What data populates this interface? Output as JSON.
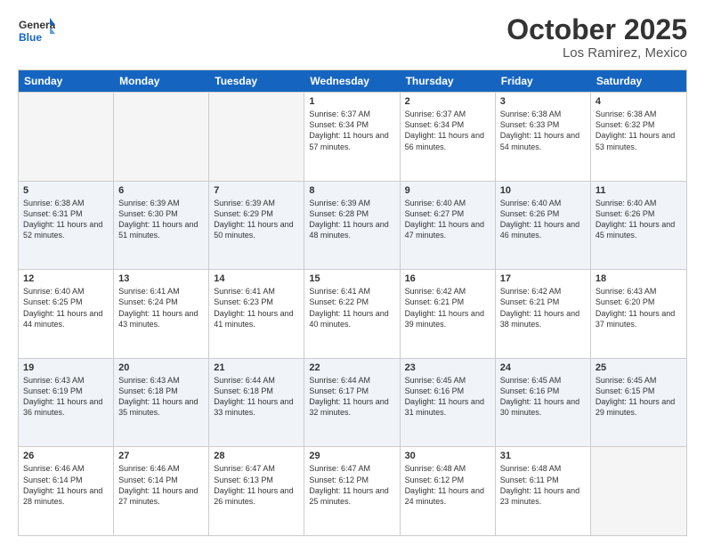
{
  "header": {
    "logo_general": "General",
    "logo_blue": "Blue",
    "month_title": "October 2025",
    "location": "Los Ramirez, Mexico"
  },
  "weekdays": [
    "Sunday",
    "Monday",
    "Tuesday",
    "Wednesday",
    "Thursday",
    "Friday",
    "Saturday"
  ],
  "rows": [
    [
      {
        "day": "",
        "info": ""
      },
      {
        "day": "",
        "info": ""
      },
      {
        "day": "",
        "info": ""
      },
      {
        "day": "1",
        "info": "Sunrise: 6:37 AM\nSunset: 6:34 PM\nDaylight: 11 hours and 57 minutes."
      },
      {
        "day": "2",
        "info": "Sunrise: 6:37 AM\nSunset: 6:34 PM\nDaylight: 11 hours and 56 minutes."
      },
      {
        "day": "3",
        "info": "Sunrise: 6:38 AM\nSunset: 6:33 PM\nDaylight: 11 hours and 54 minutes."
      },
      {
        "day": "4",
        "info": "Sunrise: 6:38 AM\nSunset: 6:32 PM\nDaylight: 11 hours and 53 minutes."
      }
    ],
    [
      {
        "day": "5",
        "info": "Sunrise: 6:38 AM\nSunset: 6:31 PM\nDaylight: 11 hours and 52 minutes."
      },
      {
        "day": "6",
        "info": "Sunrise: 6:39 AM\nSunset: 6:30 PM\nDaylight: 11 hours and 51 minutes."
      },
      {
        "day": "7",
        "info": "Sunrise: 6:39 AM\nSunset: 6:29 PM\nDaylight: 11 hours and 50 minutes."
      },
      {
        "day": "8",
        "info": "Sunrise: 6:39 AM\nSunset: 6:28 PM\nDaylight: 11 hours and 48 minutes."
      },
      {
        "day": "9",
        "info": "Sunrise: 6:40 AM\nSunset: 6:27 PM\nDaylight: 11 hours and 47 minutes."
      },
      {
        "day": "10",
        "info": "Sunrise: 6:40 AM\nSunset: 6:26 PM\nDaylight: 11 hours and 46 minutes."
      },
      {
        "day": "11",
        "info": "Sunrise: 6:40 AM\nSunset: 6:26 PM\nDaylight: 11 hours and 45 minutes."
      }
    ],
    [
      {
        "day": "12",
        "info": "Sunrise: 6:40 AM\nSunset: 6:25 PM\nDaylight: 11 hours and 44 minutes."
      },
      {
        "day": "13",
        "info": "Sunrise: 6:41 AM\nSunset: 6:24 PM\nDaylight: 11 hours and 43 minutes."
      },
      {
        "day": "14",
        "info": "Sunrise: 6:41 AM\nSunset: 6:23 PM\nDaylight: 11 hours and 41 minutes."
      },
      {
        "day": "15",
        "info": "Sunrise: 6:41 AM\nSunset: 6:22 PM\nDaylight: 11 hours and 40 minutes."
      },
      {
        "day": "16",
        "info": "Sunrise: 6:42 AM\nSunset: 6:21 PM\nDaylight: 11 hours and 39 minutes."
      },
      {
        "day": "17",
        "info": "Sunrise: 6:42 AM\nSunset: 6:21 PM\nDaylight: 11 hours and 38 minutes."
      },
      {
        "day": "18",
        "info": "Sunrise: 6:43 AM\nSunset: 6:20 PM\nDaylight: 11 hours and 37 minutes."
      }
    ],
    [
      {
        "day": "19",
        "info": "Sunrise: 6:43 AM\nSunset: 6:19 PM\nDaylight: 11 hours and 36 minutes."
      },
      {
        "day": "20",
        "info": "Sunrise: 6:43 AM\nSunset: 6:18 PM\nDaylight: 11 hours and 35 minutes."
      },
      {
        "day": "21",
        "info": "Sunrise: 6:44 AM\nSunset: 6:18 PM\nDaylight: 11 hours and 33 minutes."
      },
      {
        "day": "22",
        "info": "Sunrise: 6:44 AM\nSunset: 6:17 PM\nDaylight: 11 hours and 32 minutes."
      },
      {
        "day": "23",
        "info": "Sunrise: 6:45 AM\nSunset: 6:16 PM\nDaylight: 11 hours and 31 minutes."
      },
      {
        "day": "24",
        "info": "Sunrise: 6:45 AM\nSunset: 6:16 PM\nDaylight: 11 hours and 30 minutes."
      },
      {
        "day": "25",
        "info": "Sunrise: 6:45 AM\nSunset: 6:15 PM\nDaylight: 11 hours and 29 minutes."
      }
    ],
    [
      {
        "day": "26",
        "info": "Sunrise: 6:46 AM\nSunset: 6:14 PM\nDaylight: 11 hours and 28 minutes."
      },
      {
        "day": "27",
        "info": "Sunrise: 6:46 AM\nSunset: 6:14 PM\nDaylight: 11 hours and 27 minutes."
      },
      {
        "day": "28",
        "info": "Sunrise: 6:47 AM\nSunset: 6:13 PM\nDaylight: 11 hours and 26 minutes."
      },
      {
        "day": "29",
        "info": "Sunrise: 6:47 AM\nSunset: 6:12 PM\nDaylight: 11 hours and 25 minutes."
      },
      {
        "day": "30",
        "info": "Sunrise: 6:48 AM\nSunset: 6:12 PM\nDaylight: 11 hours and 24 minutes."
      },
      {
        "day": "31",
        "info": "Sunrise: 6:48 AM\nSunset: 6:11 PM\nDaylight: 11 hours and 23 minutes."
      },
      {
        "day": "",
        "info": ""
      }
    ]
  ]
}
